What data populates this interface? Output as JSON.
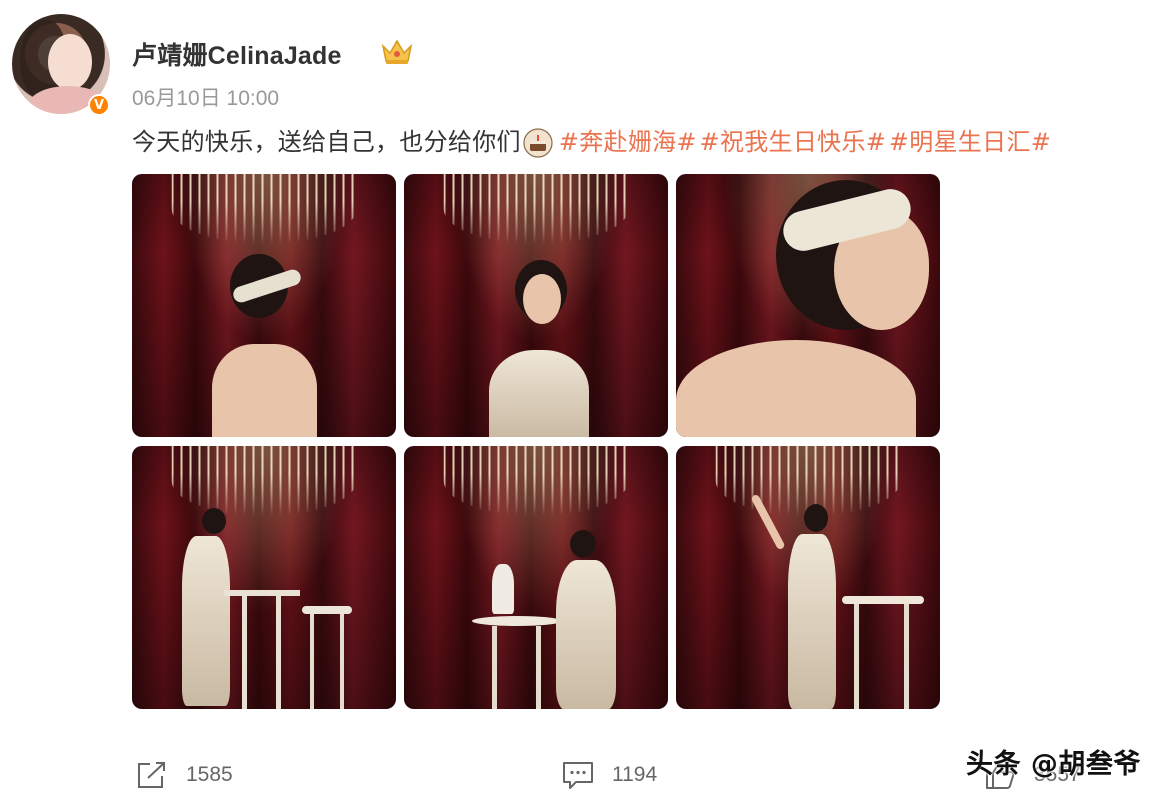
{
  "post": {
    "username": "卢靖姗CelinaJade",
    "verified_badge": "V",
    "time": "06月10日 10:00",
    "text_main": "今天的快乐，送给自己，也分给你们",
    "hashtags": [
      "#奔赴姗海#",
      "#祝我生日快乐#",
      "#明星生日汇#"
    ]
  },
  "photos": [
    {
      "icon": "photo-backless-headpiece"
    },
    {
      "icon": "photo-hands-clasped-smile"
    },
    {
      "icon": "photo-profile-pearls"
    },
    {
      "icon": "photo-standing-bar-table"
    },
    {
      "icon": "photo-sitting-table-flowers"
    },
    {
      "icon": "photo-arm-raised-dress"
    }
  ],
  "actions": {
    "repost_count": "1585",
    "comment_count": "1194",
    "like_count": "3557"
  },
  "watermark": "头条 @胡叁爷",
  "colors": {
    "hashtag": "#eb7350",
    "verified": "#ff8200",
    "curtain": "#6e1219"
  }
}
